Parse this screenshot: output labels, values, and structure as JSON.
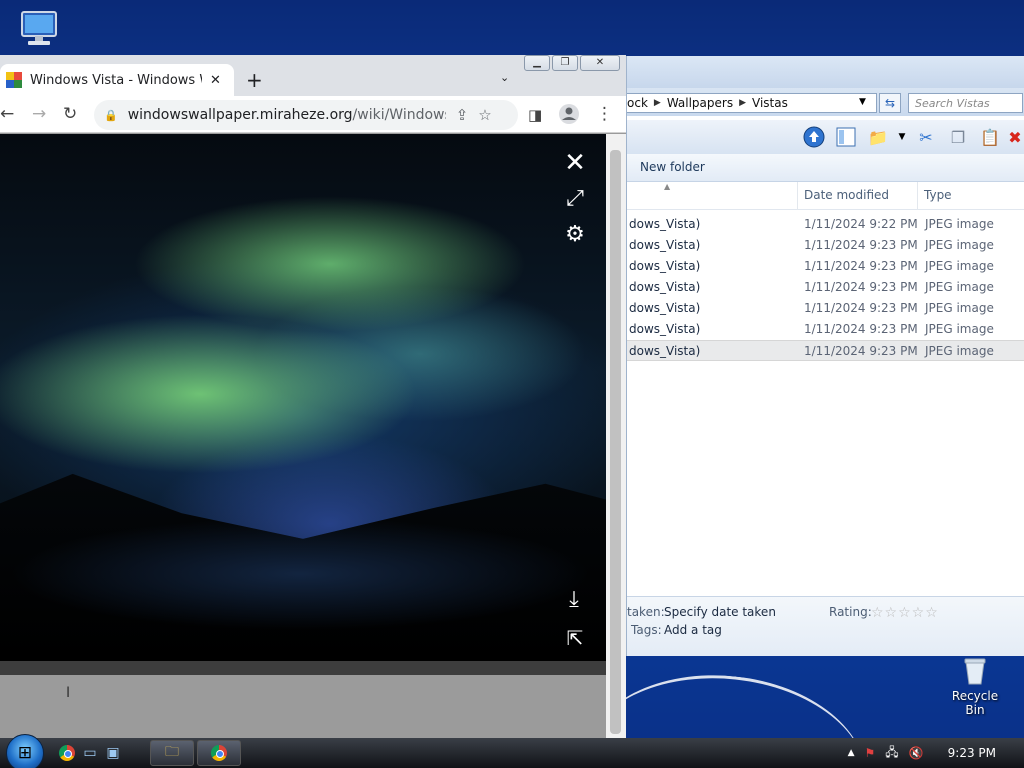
{
  "desktop": {
    "recycle_bin_label": "Recycle Bin"
  },
  "explorer": {
    "breadcrumbs": [
      "ock",
      "Wallpapers",
      "Vistas"
    ],
    "search_placeholder": "Search Vistas",
    "command_bar": {
      "new_folder": "New folder"
    },
    "columns": {
      "date_modified": "Date modified",
      "type": "Type"
    },
    "files": [
      {
        "name": "dows_Vista)",
        "date": "1/11/2024 9:22 PM",
        "type": "JPEG image"
      },
      {
        "name": "dows_Vista)",
        "date": "1/11/2024 9:23 PM",
        "type": "JPEG image"
      },
      {
        "name": "dows_Vista)",
        "date": "1/11/2024 9:23 PM",
        "type": "JPEG image"
      },
      {
        "name": "dows_Vista)",
        "date": "1/11/2024 9:23 PM",
        "type": "JPEG image"
      },
      {
        "name": "dows_Vista)",
        "date": "1/11/2024 9:23 PM",
        "type": "JPEG image"
      },
      {
        "name": "dows_Vista)",
        "date": "1/11/2024 9:23 PM",
        "type": "JPEG image"
      },
      {
        "name": "dows_Vista)",
        "date": "1/11/2024 9:23 PM",
        "type": "JPEG image"
      }
    ],
    "details": {
      "date_taken_label": "taken:",
      "date_taken_value": "Specify date taken",
      "rating_label": "Rating:",
      "tags_label": "Tags:",
      "tags_value": "Add a tag"
    }
  },
  "chrome": {
    "tab_title": "Windows Vista - Windows Wallpaper",
    "url_host": "windowswallpaper.miraheze.org",
    "url_path": "/wiki/Windows_Vi..."
  },
  "taskbar": {
    "clock": "9:23 PM"
  }
}
